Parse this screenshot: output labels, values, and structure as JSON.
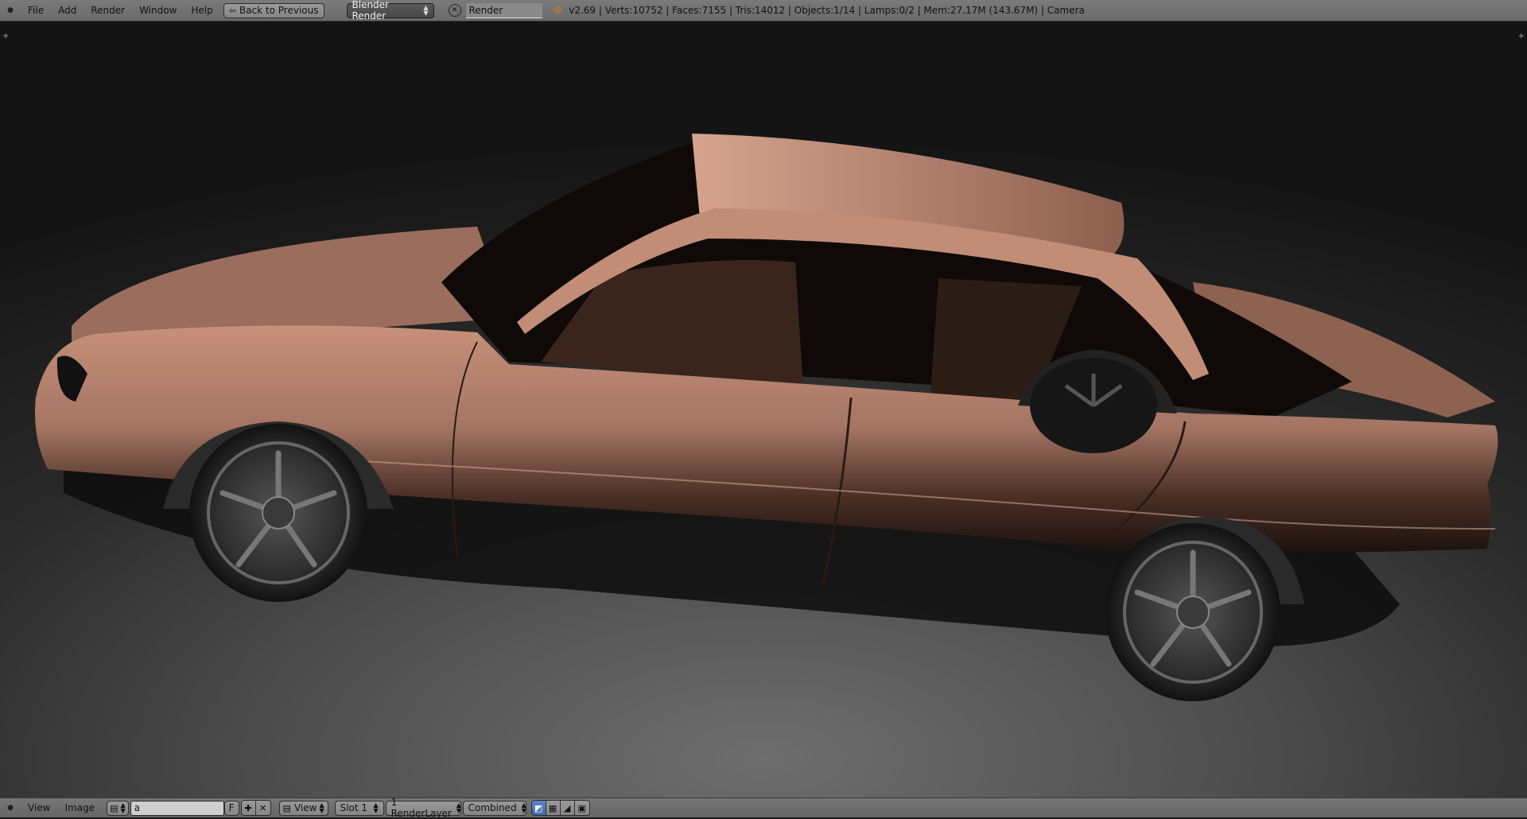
{
  "topbar": {
    "menu": [
      "File",
      "Add",
      "Render",
      "Window",
      "Help"
    ],
    "back_button": "Back to Previous",
    "engine": "Blender Render",
    "scene_field": "Render",
    "status": "v2.69 | Verts:10752 | Faces:7155 | Tris:14012 | Objects:1/14 | Lamps:0/2 | Mem:27.17M (143.67M) | Camera"
  },
  "bottombar": {
    "menu": [
      "View",
      "Image"
    ],
    "image_name": "a",
    "fake_user": "F",
    "view_dropdown": "View",
    "slot": "Slot 1",
    "render_layer": "1 RenderLayer",
    "pass": "Combined"
  },
  "icons": {
    "area_menu": "area-menu-icon",
    "back": "back-icon",
    "close": "close-icon",
    "blender": "blender-logo-icon",
    "image_browse": "image-browse-icon",
    "new": "plus-icon",
    "unlink": "x-icon",
    "display_channels": [
      "rgb-icon",
      "alpha-icon",
      "z-icon",
      "color-picker-icon"
    ]
  },
  "colors": {
    "car_body": "#a07563",
    "background": "#1a1a1a",
    "header": "#727272",
    "selected": "#5680c2"
  }
}
